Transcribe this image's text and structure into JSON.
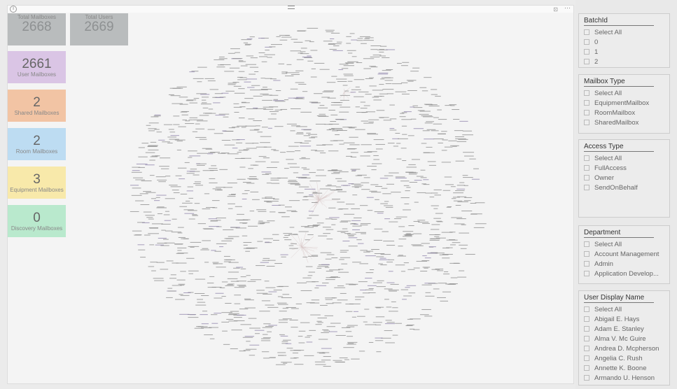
{
  "cards": {
    "total_mailboxes": {
      "label": "Total Mailboxes",
      "value": "2668",
      "color": "#b9bcbd"
    },
    "total_users": {
      "label": "Total Users",
      "value": "2669",
      "color": "#b9bcbd"
    },
    "user": {
      "label": "User Mailboxes",
      "value": "2661",
      "color": "#dac5e5"
    },
    "shared": {
      "label": "Shared Mailboxes",
      "value": "2",
      "color": "#f2c4a4"
    },
    "room": {
      "label": "Room Mailboxes",
      "value": "2",
      "color": "#bddcf2"
    },
    "equipment": {
      "label": "Equipment Mailboxes",
      "value": "3",
      "color": "#f8e9aa"
    },
    "discovery": {
      "label": "Discovery Mailboxes",
      "value": "0",
      "color": "#b9e9cd"
    }
  },
  "visual_header": {
    "info_icon": "info-icon",
    "focus_icon": "focus-mode-icon",
    "more": "···"
  },
  "slicers": [
    {
      "title": "BatchId",
      "items": [
        "Select All",
        "0",
        "1",
        "2"
      ]
    },
    {
      "title": "Mailbox Type",
      "items": [
        "Select All",
        "EquipmentMailbox",
        "RoomMailbox",
        "SharedMailbox"
      ]
    },
    {
      "title": "Access Type",
      "items": [
        "Select All",
        "FullAccess",
        "Owner",
        "SendOnBehalf"
      ]
    },
    {
      "title": "Department",
      "items": [
        "Select All",
        "Account Management",
        "Admin",
        "Application Develop..."
      ]
    },
    {
      "title": "User Display Name",
      "items": [
        "Select All",
        "Abigail E. Hays",
        "Adam E. Stanley",
        "Alma V. Mc Guire",
        "Andrea D. Mcpherson",
        "Angelia C. Rush",
        "Annette K. Boone",
        "Armando U. Henson"
      ]
    }
  ]
}
